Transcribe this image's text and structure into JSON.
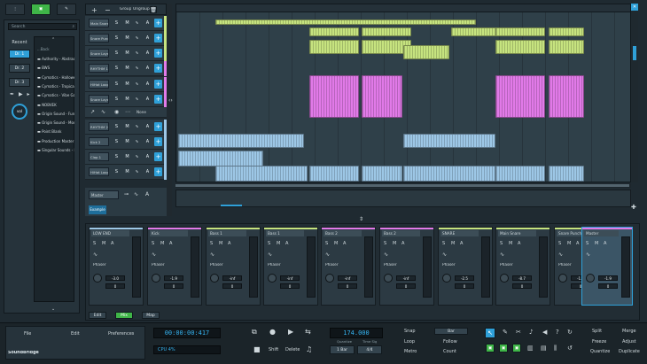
{
  "toolbar": {
    "group_label": "Group",
    "ungroup_label": "Ungroup"
  },
  "browser": {
    "search_placeholder": "Search",
    "side_tabs": [
      "Recent",
      "Dr. 1",
      "Dr. 2",
      "Dr. 3"
    ],
    "back_label": "...Back",
    "folders": [
      "Authority - Abstract",
      "BWS",
      "Cymatics - Halloween",
      "Cymatics - Tropical 1",
      "Cymatics - Vibe Gam",
      "NOBVEK",
      "Origin Sound - Funda",
      "Origin Sound - Modern",
      "Point Blank",
      "Production Master -",
      "Singular Sounds - Fa"
    ]
  },
  "tracks": [
    {
      "name": "Main Snare"
    },
    {
      "name": "Snare Punch"
    },
    {
      "name": "Snare Layer 1"
    },
    {
      "name": "RHYTHM 1"
    },
    {
      "name": "HiHat Loop"
    },
    {
      "name": "Snare Layer 2"
    },
    {
      "name": "RHYTHM 2"
    },
    {
      "name": "Kick 2"
    },
    {
      "name": "Clap 1"
    },
    {
      "name": "HiHat Loop 2"
    }
  ],
  "track_controls": {
    "s": "S",
    "m": "M",
    "a": "A",
    "none_label": "None"
  },
  "master": {
    "name": "Master",
    "example_label": "Example"
  },
  "mixer": {
    "channels": [
      {
        "name": "LOW END",
        "fx": "Phaser",
        "vol": "-3.0",
        "pan": "0"
      },
      {
        "name": "Kick",
        "fx": "Phaser",
        "vol": "-1.9",
        "pan": "0"
      },
      {
        "name": "Bass 1",
        "fx": "Phaser",
        "vol": "-inf",
        "pan": "0"
      },
      {
        "name": "Bass 1",
        "fx": "Phaser",
        "vol": "-inf",
        "pan": "0"
      },
      {
        "name": "Bass 2",
        "fx": "Phaser",
        "vol": "-inf",
        "pan": "0"
      },
      {
        "name": "Bass 2",
        "fx": "Phaser",
        "vol": "-inf",
        "pan": "0"
      },
      {
        "name": "SNARE",
        "fx": "Phaser",
        "vol": "-2.5",
        "pan": "0"
      },
      {
        "name": "Main Snare",
        "fx": "Phaser",
        "vol": "-8.7",
        "pan": "0"
      },
      {
        "name": "Snare Punch",
        "fx": "Phaser",
        "vol": "-1.4",
        "pan": "0"
      },
      {
        "name": "Master",
        "fx": "",
        "vol": "-1.9",
        "pan": "0"
      }
    ],
    "tabs": [
      "Edit",
      "Mix",
      "Map"
    ]
  },
  "bottom": {
    "file": "File",
    "edit": "Edit",
    "preferences": "Preferences",
    "logo": "SoundBridge",
    "time": "00:00:00:417",
    "cpu": "CPU 4%",
    "tempo": "174.000",
    "shift": "Shift",
    "delete": "Delete",
    "quantize_label": "Quantize",
    "time_sig_label": "Time Sig",
    "bar_value": "1 Bar",
    "sig_value": "4/4",
    "snap": "Snap",
    "loop": "Loop",
    "metro": "Metro",
    "snap_sel": "Bar",
    "follow": "Follow",
    "count": "Count",
    "split": "Split",
    "merge": "Merge",
    "freeze": "Freeze",
    "adjust": "Adjust",
    "quantize": "Quantize",
    "duplicate": "Duplicate"
  },
  "colors": {
    "accent": "#2fa0d8",
    "green": "#c6e37f",
    "pink": "#e17ae8",
    "blue": "#9dc7e6",
    "lime": "#52d65a"
  }
}
